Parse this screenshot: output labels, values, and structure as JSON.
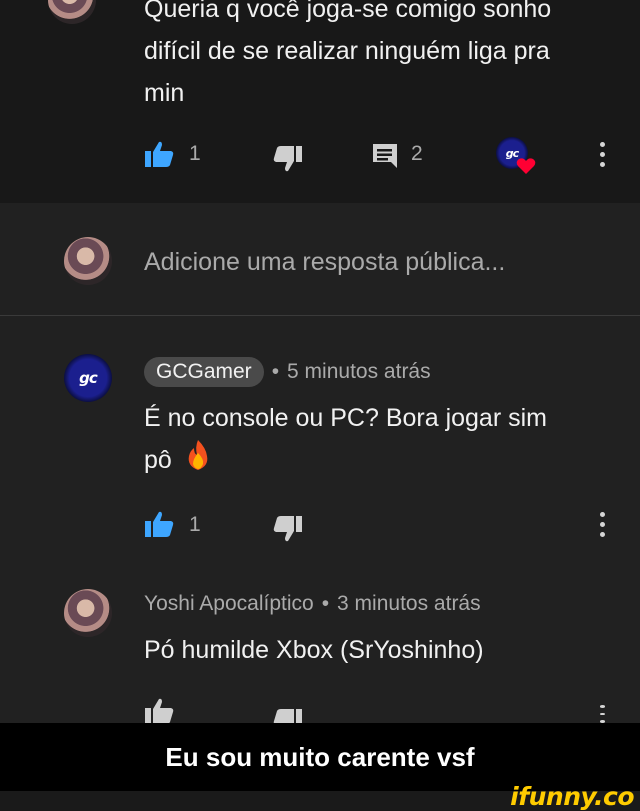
{
  "parent_comment": {
    "text_line1": "Queria q você joga-se comigo sonho",
    "text_line2": "difícil de se realizar ninguém liga pra",
    "text_line3": "min",
    "like_count": "1",
    "reply_count": "2",
    "icons": [
      "thumb-up-icon",
      "thumb-down-icon",
      "comment-icon",
      "creator-heart-icon",
      "more-icon"
    ]
  },
  "reply_input": {
    "placeholder": "Adicione uma resposta pública..."
  },
  "replies": [
    {
      "author": "GCGamer",
      "separator": "•",
      "time": "5 minutos atrás",
      "text_line1": "É no console ou PC? Bora jogar sim",
      "text_line2": "pô",
      "emoji": "🔥",
      "like_count": "1"
    },
    {
      "author": "Yoshi Apocalíptico",
      "separator": "•",
      "time": "3 minutos atrás",
      "text": "Pó humilde Xbox (SrYoshinho)"
    }
  ],
  "caption": "Eu sou muito carente vsf",
  "watermark": "ifunny.co",
  "avatar_logo": "gc",
  "colors": {
    "like_blue": "#3ea6ff",
    "heart_red": "#ff0033",
    "watermark_yellow": "#ffcc00"
  }
}
